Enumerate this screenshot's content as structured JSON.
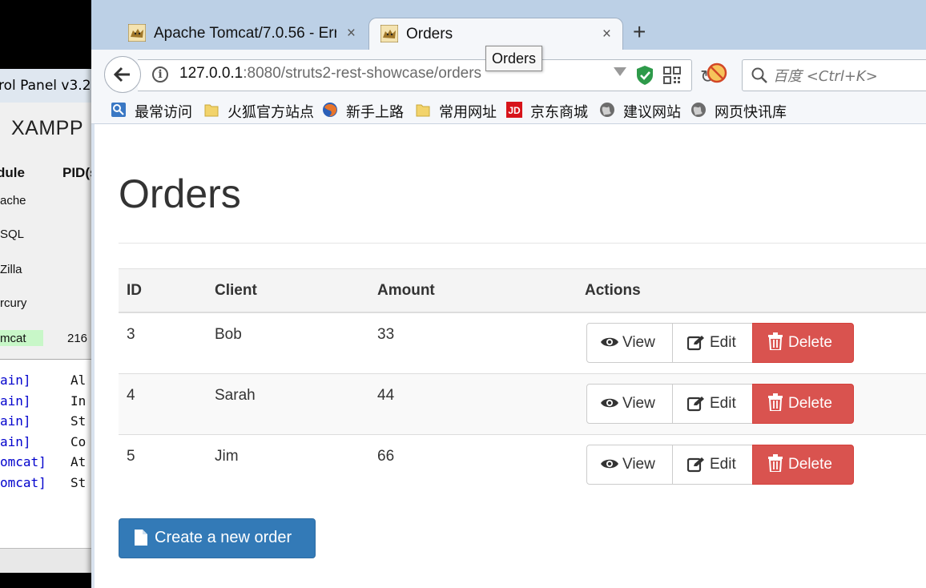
{
  "xampp": {
    "title": "rol Panel v3.2",
    "logo": "XAMPP",
    "col_module": "dule",
    "col_pid": "PID(s",
    "modules": [
      "ache",
      "SQL",
      "Zilla",
      "rcury",
      "mcat"
    ],
    "tomcat_pid": "216",
    "log": [
      {
        "src": "ain]",
        "msg": "Al"
      },
      {
        "src": "ain]",
        "msg": "In"
      },
      {
        "src": "ain]",
        "msg": "St"
      },
      {
        "src": "ain]",
        "msg": "Co"
      },
      {
        "src": "omcat]",
        "msg": "At"
      },
      {
        "src": "omcat]",
        "msg": "St"
      }
    ]
  },
  "browser": {
    "tabs": [
      {
        "label": "Apache Tomcat/7.0.56 - Err",
        "active": false
      },
      {
        "label": "Orders",
        "active": true
      }
    ],
    "new_tab_symbol": "+",
    "close_symbol": "×",
    "url_host": "127.0.0.1",
    "url_rest": ":8080/struts2-rest-showcase/orders",
    "tooltip": "Orders",
    "search_placeholder": "百度 <Ctrl+K>",
    "bookmarks": [
      {
        "label": "最常访问",
        "icon": "most-visited-icon"
      },
      {
        "label": "火狐官方站点",
        "icon": "folder-icon"
      },
      {
        "label": "新手上路",
        "icon": "firefox-icon"
      },
      {
        "label": "常用网址",
        "icon": "folder-icon"
      },
      {
        "label": "京东商城",
        "icon": "jd-icon"
      },
      {
        "label": "建议网站",
        "icon": "globe-icon"
      },
      {
        "label": "网页快讯库",
        "icon": "globe-icon"
      }
    ]
  },
  "page": {
    "title": "Orders",
    "table": {
      "headers": [
        "ID",
        "Client",
        "Amount",
        "Actions"
      ],
      "rows": [
        {
          "id": "3",
          "client": "Bob",
          "amount": "33"
        },
        {
          "id": "4",
          "client": "Sarah",
          "amount": "44"
        },
        {
          "id": "5",
          "client": "Jim",
          "amount": "66"
        }
      ]
    },
    "actions": {
      "view": "View",
      "edit": "Edit",
      "delete": "Delete"
    },
    "create_button": "Create a new order"
  },
  "colors": {
    "primary": "#337ab7",
    "danger": "#d9534f",
    "tab_strip": "#bcd0e6"
  }
}
